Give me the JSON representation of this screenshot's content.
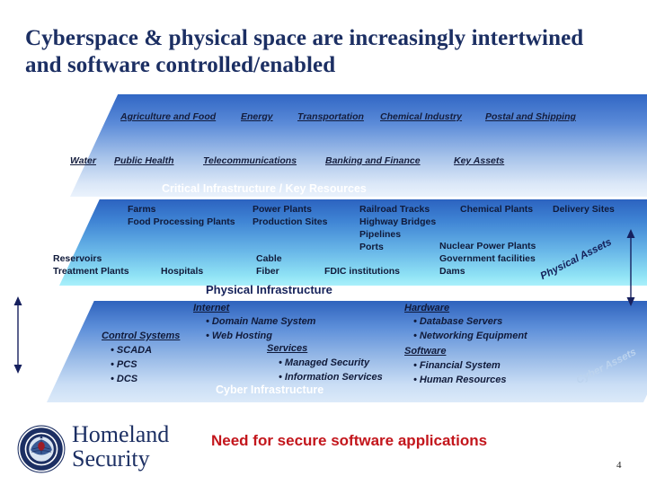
{
  "slide": {
    "title": "Cyberspace & physical space are increasingly intertwined and software controlled/enabled",
    "page_number": "4",
    "caption": "Need for secure software applications"
  },
  "branding": {
    "seal_icon": "dhs-seal-icon",
    "line1": "Homeland",
    "line2": "Security"
  },
  "top_layer": {
    "band_label": "Critical Infrastructure / Key Resources",
    "row1": [
      "Agriculture and Food",
      "Energy",
      "Transportation",
      "Chemical Industry",
      "Postal and Shipping"
    ],
    "row2": [
      "Water",
      "Public Health",
      "Telecommunications",
      "Banking and Finance",
      "Key Assets"
    ]
  },
  "middle_layer": {
    "band_label": "Physical Infrastructure",
    "side_label": "Physical Assets",
    "groups": [
      {
        "items": [
          "Farms",
          "Food Processing Plants"
        ]
      },
      {
        "items": [
          "Power Plants",
          "Production Sites"
        ]
      },
      {
        "items": [
          "Railroad Tracks",
          "Highway Bridges",
          "Pipelines",
          "Ports"
        ]
      },
      {
        "items": [
          "Chemical Plants"
        ]
      },
      {
        "items": [
          "Delivery Sites"
        ]
      },
      {
        "items": [
          "Reservoirs",
          "Treatment Plants"
        ]
      },
      {
        "items": [
          "Hospitals"
        ]
      },
      {
        "items": [
          "Cable",
          "Fiber"
        ]
      },
      {
        "items": [
          "FDIC institutions"
        ]
      },
      {
        "items": [
          "Nuclear Power Plants",
          "Government facilities",
          "Dams"
        ]
      }
    ]
  },
  "bottom_layer": {
    "band_label": "Cyber Infrastructure",
    "side_label": "Cyber Assets",
    "groups": [
      {
        "heading": "Control Systems",
        "items": [
          "SCADA",
          "PCS",
          "DCS"
        ]
      },
      {
        "heading": "Internet",
        "items": [
          "Domain Name System",
          "Web Hosting"
        ]
      },
      {
        "heading": "Services",
        "items": [
          "Managed Security",
          "Information Services"
        ]
      },
      {
        "heading": "Hardware",
        "items": [
          "Database Servers",
          "Networking Equipment"
        ]
      },
      {
        "heading": "Software",
        "items": [
          "Financial System",
          "Human Resources"
        ]
      }
    ]
  },
  "arrows": {
    "left_icon": "double-arrow-vertical-icon",
    "right_icon": "double-arrow-vertical-icon"
  }
}
